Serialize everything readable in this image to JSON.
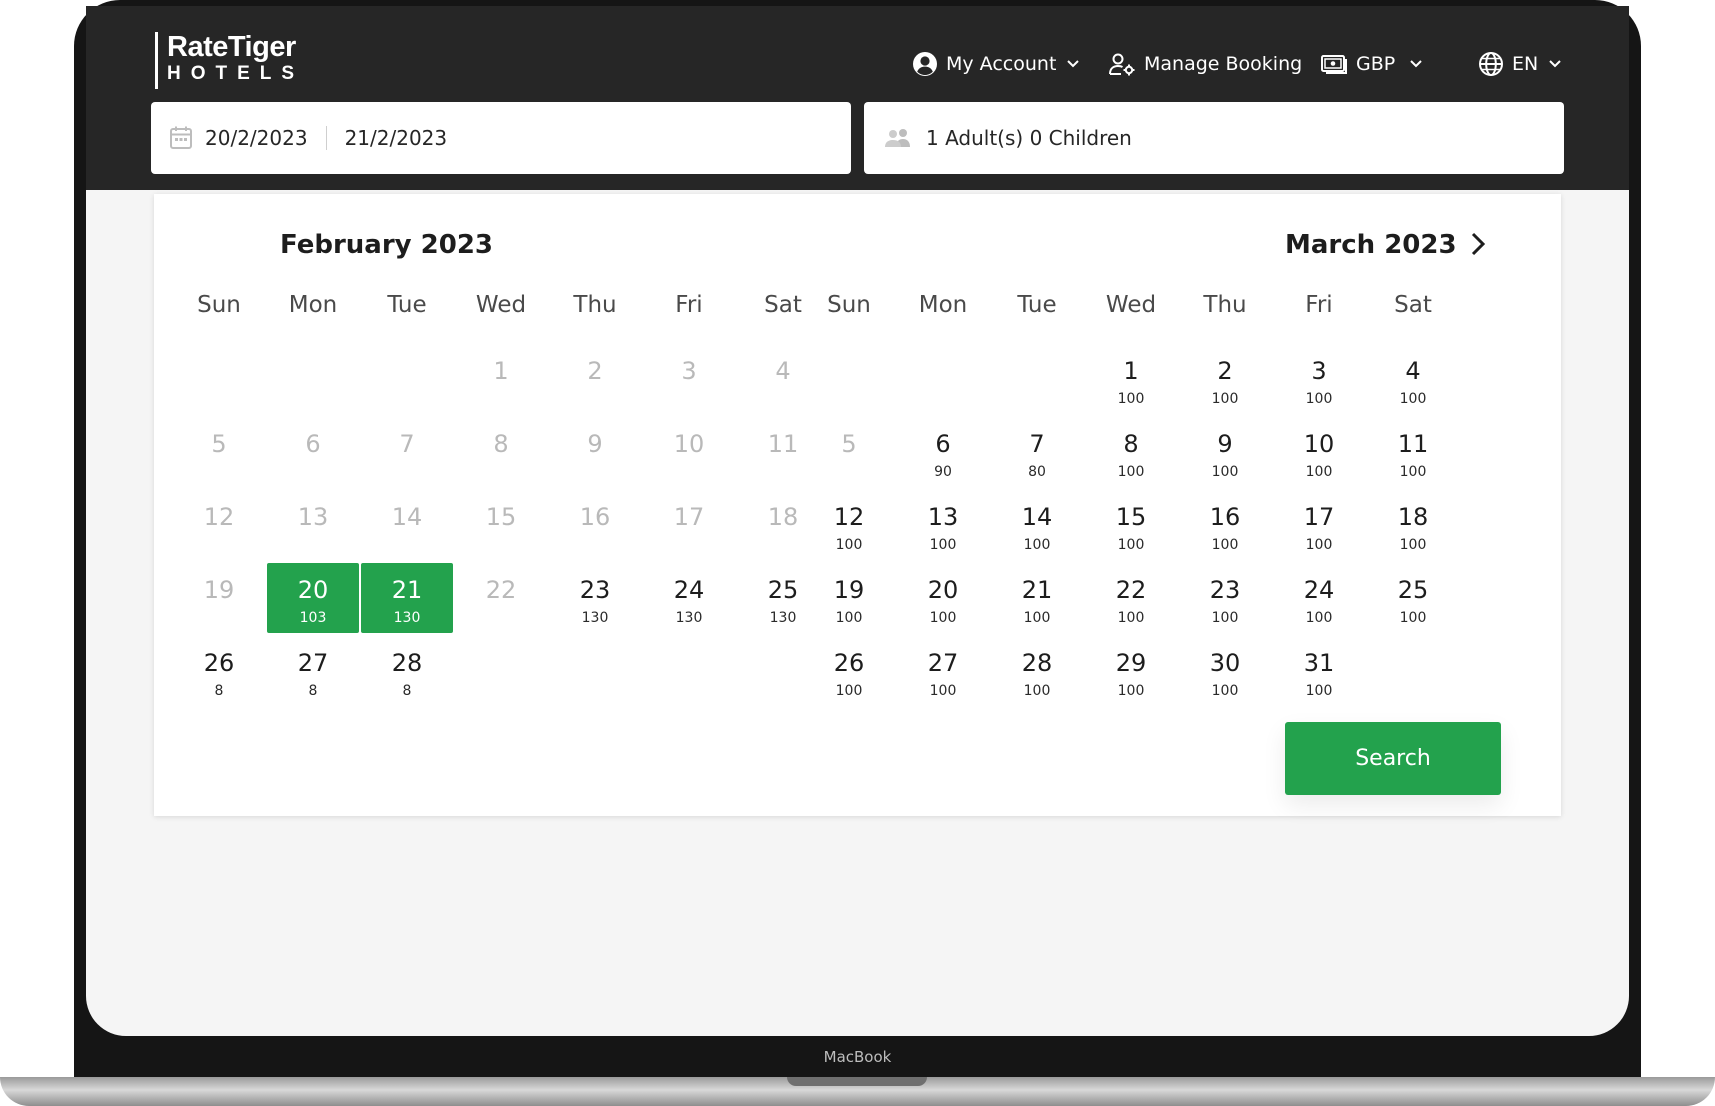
{
  "branding": {
    "logo_top": "RateTiger",
    "logo_bottom": "HOTELS"
  },
  "nav": {
    "my_account": "My Account",
    "manage_booking": "Manage Booking",
    "currency": "GBP",
    "language": "EN"
  },
  "search_bar": {
    "check_in": "20/2/2023",
    "check_out": "21/2/2023",
    "guests": "1 Adult(s) 0 Children"
  },
  "calendar": {
    "weekdays": [
      "Sun",
      "Mon",
      "Tue",
      "Wed",
      "Thu",
      "Fri",
      "Sat"
    ],
    "months": [
      {
        "title": "February 2023",
        "first_weekday": 3,
        "days": [
          {
            "d": "1",
            "p": "",
            "disabled": true
          },
          {
            "d": "2",
            "p": "",
            "disabled": true
          },
          {
            "d": "3",
            "p": "",
            "disabled": true
          },
          {
            "d": "4",
            "p": "",
            "disabled": true
          },
          {
            "d": "5",
            "p": "",
            "disabled": true
          },
          {
            "d": "6",
            "p": "",
            "disabled": true
          },
          {
            "d": "7",
            "p": "",
            "disabled": true
          },
          {
            "d": "8",
            "p": "",
            "disabled": true
          },
          {
            "d": "9",
            "p": "",
            "disabled": true
          },
          {
            "d": "10",
            "p": "",
            "disabled": true
          },
          {
            "d": "11",
            "p": "",
            "disabled": true
          },
          {
            "d": "12",
            "p": "",
            "disabled": true
          },
          {
            "d": "13",
            "p": "",
            "disabled": true
          },
          {
            "d": "14",
            "p": "",
            "disabled": true
          },
          {
            "d": "15",
            "p": "",
            "disabled": true
          },
          {
            "d": "16",
            "p": "",
            "disabled": true
          },
          {
            "d": "17",
            "p": "",
            "disabled": true
          },
          {
            "d": "18",
            "p": "",
            "disabled": true
          },
          {
            "d": "19",
            "p": "",
            "disabled": true
          },
          {
            "d": "20",
            "p": "103",
            "selected": true
          },
          {
            "d": "21",
            "p": "130",
            "selected": true
          },
          {
            "d": "22",
            "p": "",
            "disabled": true
          },
          {
            "d": "23",
            "p": "130"
          },
          {
            "d": "24",
            "p": "130"
          },
          {
            "d": "25",
            "p": "130"
          },
          {
            "d": "26",
            "p": "8"
          },
          {
            "d": "27",
            "p": "8"
          },
          {
            "d": "28",
            "p": "8"
          }
        ]
      },
      {
        "title": "March 2023",
        "first_weekday": 3,
        "days": [
          {
            "d": "1",
            "p": "100"
          },
          {
            "d": "2",
            "p": "100"
          },
          {
            "d": "3",
            "p": "100"
          },
          {
            "d": "4",
            "p": "100"
          },
          {
            "d": "5",
            "p": "",
            "disabled": true
          },
          {
            "d": "6",
            "p": "90"
          },
          {
            "d": "7",
            "p": "80"
          },
          {
            "d": "8",
            "p": "100"
          },
          {
            "d": "9",
            "p": "100"
          },
          {
            "d": "10",
            "p": "100"
          },
          {
            "d": "11",
            "p": "100"
          },
          {
            "d": "12",
            "p": "100"
          },
          {
            "d": "13",
            "p": "100"
          },
          {
            "d": "14",
            "p": "100"
          },
          {
            "d": "15",
            "p": "100"
          },
          {
            "d": "16",
            "p": "100"
          },
          {
            "d": "17",
            "p": "100"
          },
          {
            "d": "18",
            "p": "100"
          },
          {
            "d": "19",
            "p": "100"
          },
          {
            "d": "20",
            "p": "100"
          },
          {
            "d": "21",
            "p": "100"
          },
          {
            "d": "22",
            "p": "100"
          },
          {
            "d": "23",
            "p": "100"
          },
          {
            "d": "24",
            "p": "100"
          },
          {
            "d": "25",
            "p": "100"
          },
          {
            "d": "26",
            "p": "100"
          },
          {
            "d": "27",
            "p": "100"
          },
          {
            "d": "28",
            "p": "100"
          },
          {
            "d": "29",
            "p": "100"
          },
          {
            "d": "30",
            "p": "100"
          },
          {
            "d": "31",
            "p": "100"
          }
        ]
      }
    ]
  },
  "search_button": "Search",
  "device_label": "MacBook",
  "icons": {
    "account": "user-circle-icon",
    "manage_booking": "user-gear-icon",
    "currency": "banknote-icon",
    "language": "globe-icon",
    "calendar": "calendar-icon",
    "guests": "people-icon",
    "next": "chevron-right-icon",
    "dropdown": "chevron-down-icon"
  },
  "colors": {
    "header_bg": "#262626",
    "accent_green": "#23a24d",
    "page_bg": "#f5f5f5"
  }
}
